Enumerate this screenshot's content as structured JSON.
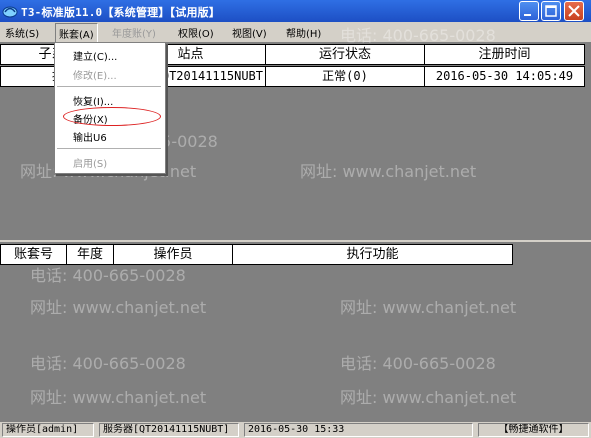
{
  "window": {
    "title": "T3-标准版11.0【系统管理】【试用版】"
  },
  "menu": {
    "system": "系统(S)",
    "account": "账套(A)",
    "year_account": "年度账(Y)",
    "permission": "权限(O)",
    "view": "视图(V)",
    "help": "帮助(H)"
  },
  "account_menu": {
    "create": "建立(C)...",
    "modify": "修改(E)...",
    "restore": "恢复(I)...",
    "backup": "备份(X)",
    "export_u6": "输出U6",
    "enable": "启用(S)"
  },
  "upper_table": {
    "columns": [
      "子系统",
      "站点",
      "运行状态",
      "注册时间"
    ],
    "rows": [
      {
        "subsystem": "控",
        "site": "QT20141115NUBT",
        "status": "正常(0)",
        "time": "2016-05-30 14:05:49"
      }
    ]
  },
  "lower_table": {
    "columns": [
      "账套号",
      "年度",
      "操作员",
      "执行功能"
    ]
  },
  "watermark": {
    "phone": "电话: 400-665-0028",
    "site": "网址: www.chanjet.net"
  },
  "status_bar": {
    "operator": "操作员[admin]",
    "server": "服务器[QT20141115NUBT]",
    "datetime": "2016-05-30 15:33",
    "brand": "【畅捷通软件】"
  },
  "colors": {
    "titlebar": "#1d4fc4",
    "close_button": "#c8401f",
    "workspace": "#808080",
    "highlight_circle": "#d22222"
  }
}
